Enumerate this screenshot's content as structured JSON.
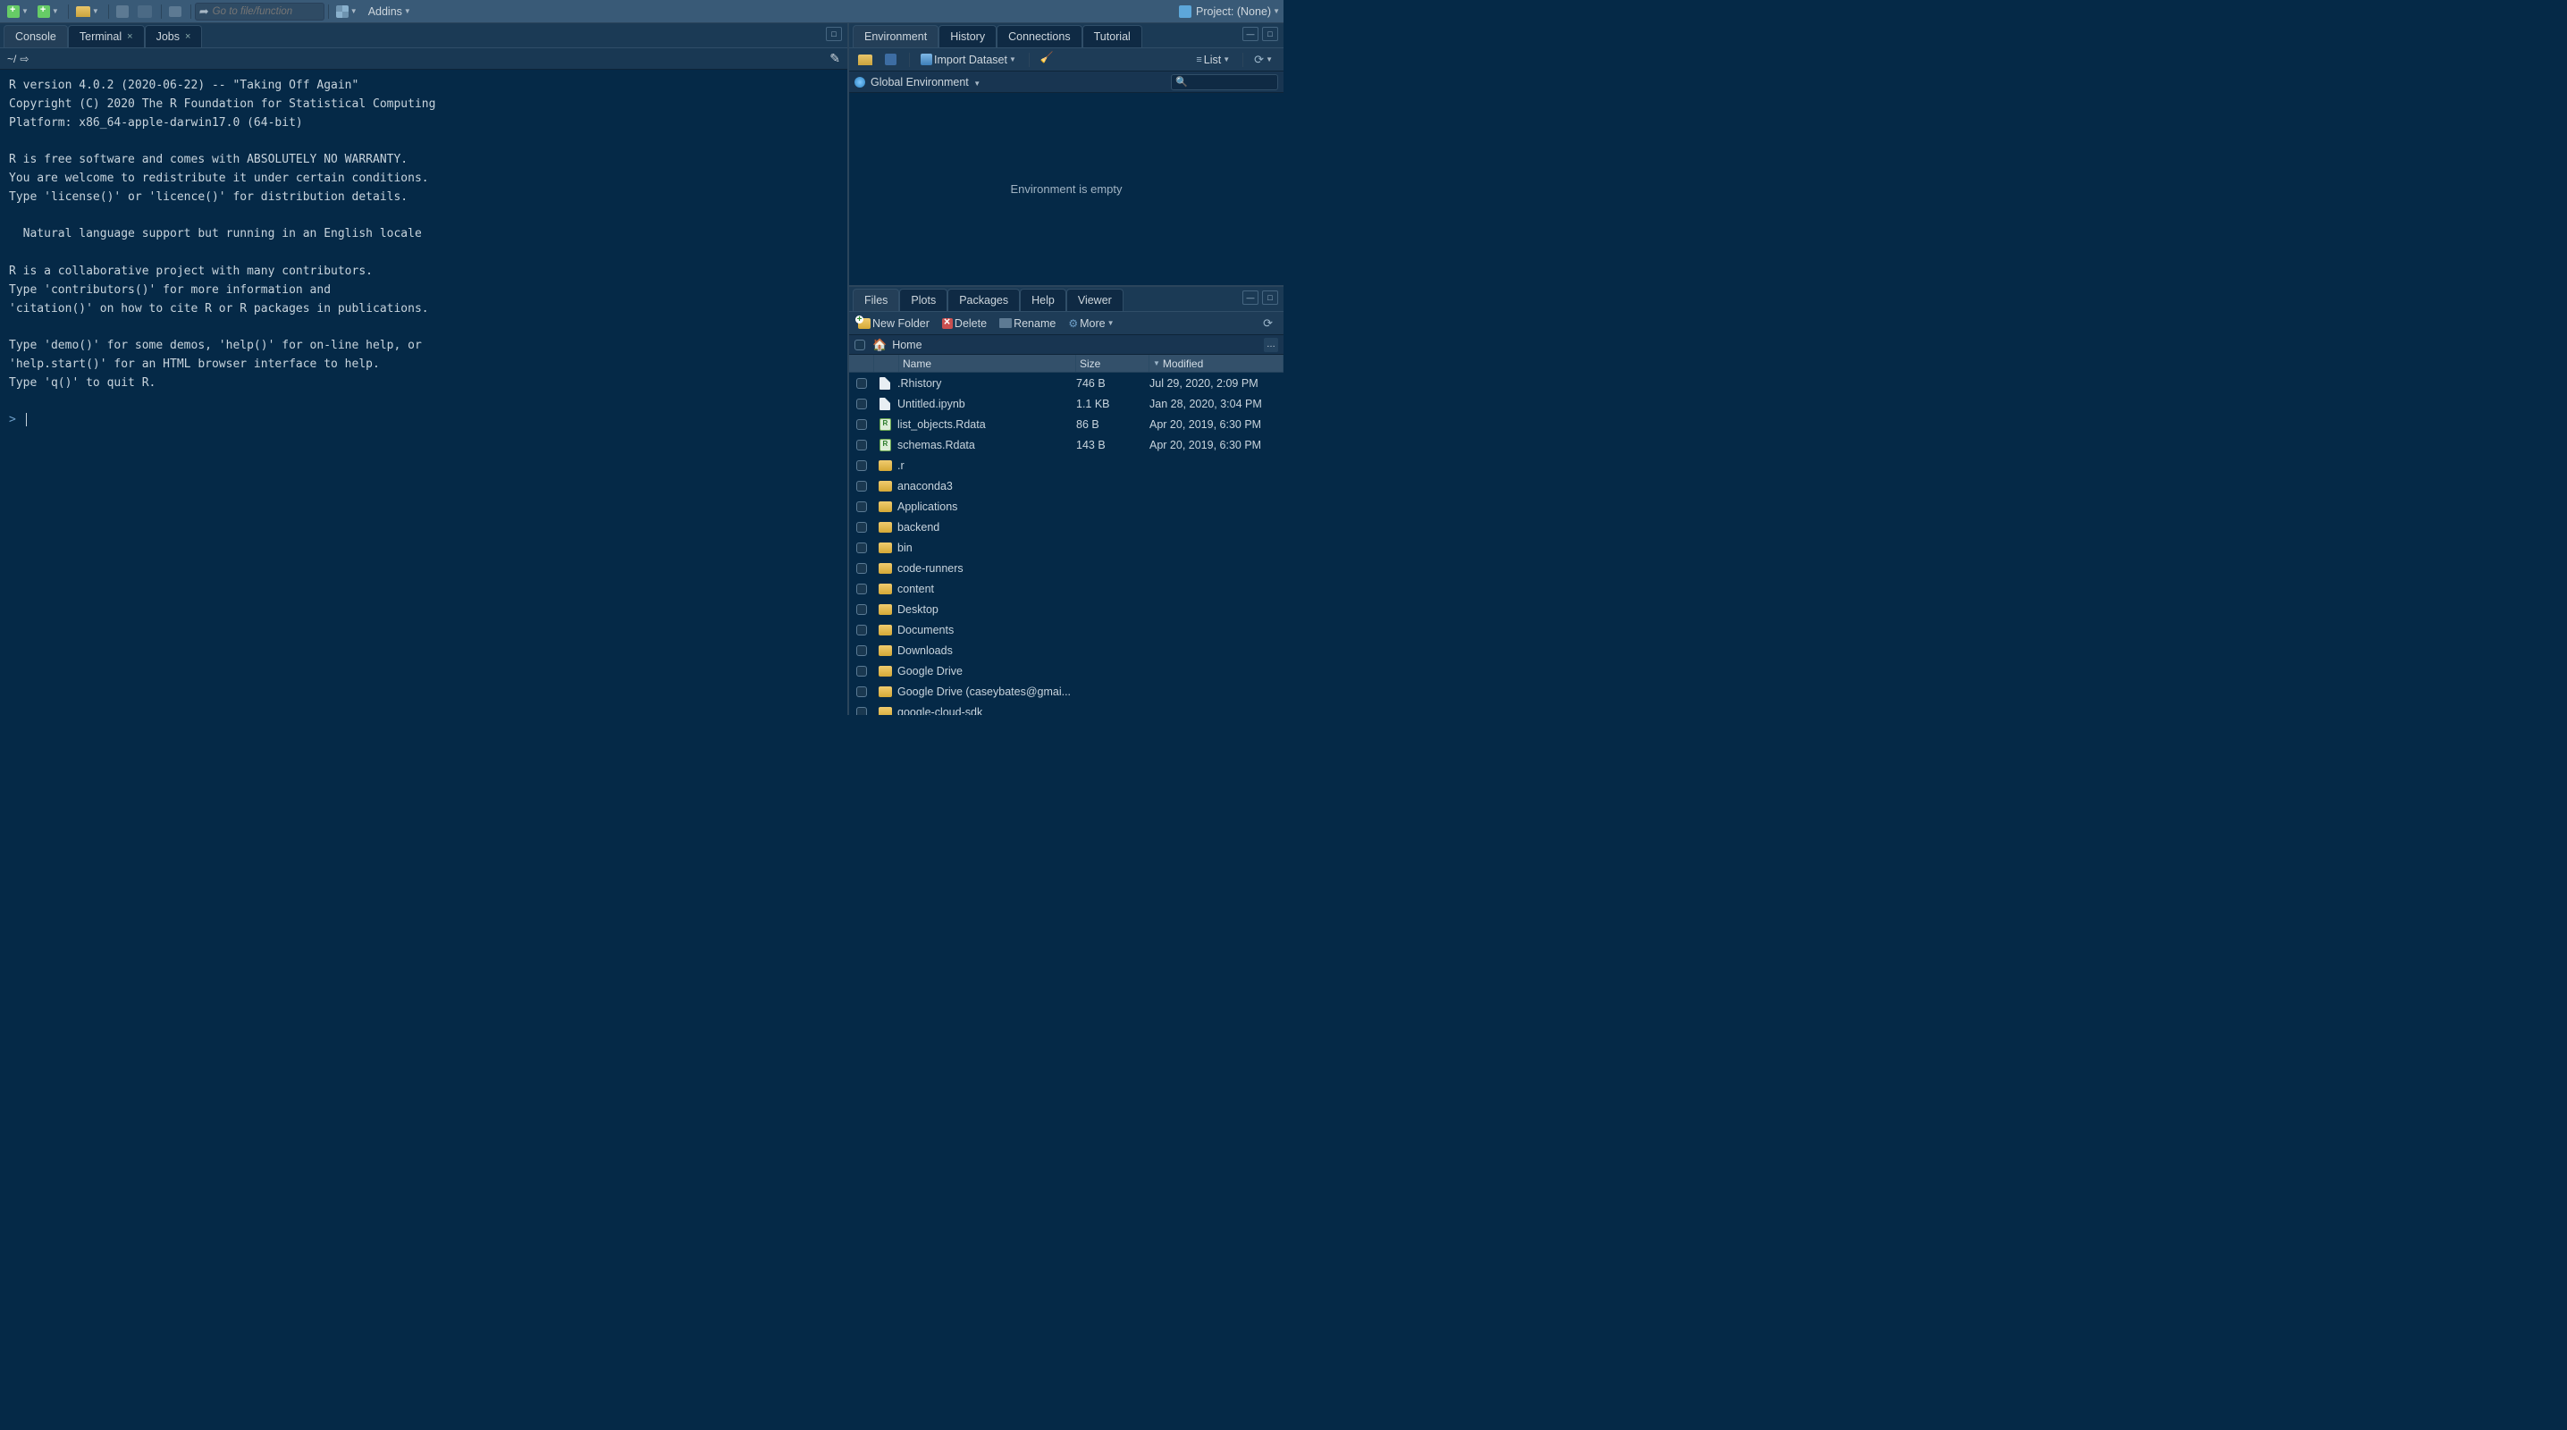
{
  "toolbar": {
    "goto_placeholder": "Go to file/function",
    "addins": "Addins",
    "project_label": "Project: (None)"
  },
  "leftPanel": {
    "tabs": {
      "console": "Console",
      "terminal": "Terminal",
      "jobs": "Jobs"
    },
    "workingDir": "~/",
    "consoleText": "R version 4.0.2 (2020-06-22) -- \"Taking Off Again\"\nCopyright (C) 2020 The R Foundation for Statistical Computing\nPlatform: x86_64-apple-darwin17.0 (64-bit)\n\nR is free software and comes with ABSOLUTELY NO WARRANTY.\nYou are welcome to redistribute it under certain conditions.\nType 'license()' or 'licence()' for distribution details.\n\n  Natural language support but running in an English locale\n\nR is a collaborative project with many contributors.\nType 'contributors()' for more information and\n'citation()' on how to cite R or R packages in publications.\n\nType 'demo()' for some demos, 'help()' for on-line help, or\n'help.start()' for an HTML browser interface to help.\nType 'q()' to quit R.\n",
    "prompt": ">"
  },
  "envPanel": {
    "tabs": {
      "environment": "Environment",
      "history": "History",
      "connections": "Connections",
      "tutorial": "Tutorial"
    },
    "toolbar": {
      "import": "Import Dataset",
      "list": "List"
    },
    "scope": "Global Environment",
    "emptyMsg": "Environment is empty"
  },
  "filesPanel": {
    "tabs": {
      "files": "Files",
      "plots": "Plots",
      "packages": "Packages",
      "help": "Help",
      "viewer": "Viewer"
    },
    "toolbar": {
      "newFolder": "New Folder",
      "delete": "Delete",
      "rename": "Rename",
      "more": "More"
    },
    "path": "Home",
    "columns": {
      "name": "Name",
      "size": "Size",
      "modified": "Modified"
    },
    "rows": [
      {
        "icon": "file",
        "name": ".Rhistory",
        "size": "746 B",
        "modified": "Jul 29, 2020, 2:09 PM"
      },
      {
        "icon": "file",
        "name": "Untitled.ipynb",
        "size": "1.1 KB",
        "modified": "Jan 28, 2020, 3:04 PM"
      },
      {
        "icon": "rdata",
        "name": "list_objects.Rdata",
        "size": "86 B",
        "modified": "Apr 20, 2019, 6:30 PM"
      },
      {
        "icon": "rdata",
        "name": "schemas.Rdata",
        "size": "143 B",
        "modified": "Apr 20, 2019, 6:30 PM"
      },
      {
        "icon": "folder",
        "name": ".r",
        "size": "",
        "modified": ""
      },
      {
        "icon": "folder",
        "name": "anaconda3",
        "size": "",
        "modified": ""
      },
      {
        "icon": "folder",
        "name": "Applications",
        "size": "",
        "modified": ""
      },
      {
        "icon": "folder",
        "name": "backend",
        "size": "",
        "modified": ""
      },
      {
        "icon": "folder",
        "name": "bin",
        "size": "",
        "modified": ""
      },
      {
        "icon": "folder",
        "name": "code-runners",
        "size": "",
        "modified": ""
      },
      {
        "icon": "folder",
        "name": "content",
        "size": "",
        "modified": ""
      },
      {
        "icon": "folder",
        "name": "Desktop",
        "size": "",
        "modified": ""
      },
      {
        "icon": "folder",
        "name": "Documents",
        "size": "",
        "modified": ""
      },
      {
        "icon": "folder",
        "name": "Downloads",
        "size": "",
        "modified": ""
      },
      {
        "icon": "folder",
        "name": "Google Drive",
        "size": "",
        "modified": ""
      },
      {
        "icon": "folder",
        "name": "Google Drive (caseybates@gmai...",
        "size": "",
        "modified": ""
      },
      {
        "icon": "folder",
        "name": "google-cloud-sdk",
        "size": "",
        "modified": ""
      }
    ]
  }
}
